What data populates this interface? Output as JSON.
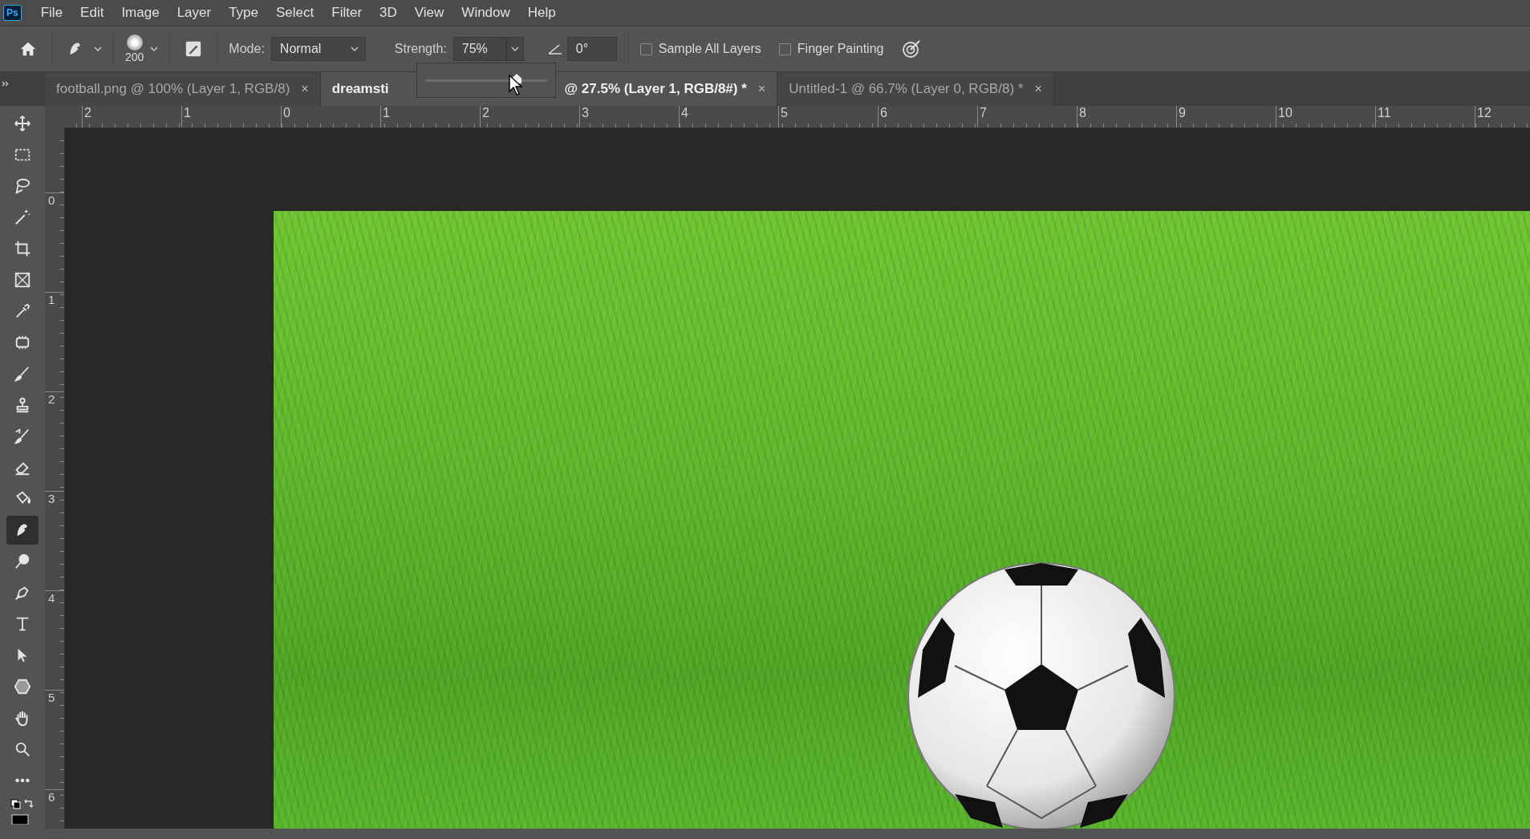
{
  "app_logo": "Ps",
  "menu": [
    "File",
    "Edit",
    "Image",
    "Layer",
    "Type",
    "Select",
    "Filter",
    "3D",
    "View",
    "Window",
    "Help"
  ],
  "options_bar": {
    "brush_size": "200",
    "mode_label": "Mode:",
    "mode_value": "Normal",
    "strength_label": "Strength:",
    "strength_value": "75%",
    "strength_slider": {
      "level": 0.75
    },
    "angle_value": "0°",
    "checkboxes": [
      {
        "label": "Sample All Layers",
        "checked": false
      },
      {
        "label": "Finger Painting",
        "checked": false
      }
    ]
  },
  "tabs": [
    {
      "label": "football.png @ 100% (Layer 1, RGB/8)",
      "close": "×",
      "selected": false
    },
    {
      "label": "dreamsti",
      "hidden_part": "@ 27.5% (Layer 1, RGB/8#) *",
      "close": "×",
      "selected": true
    },
    {
      "label": "Untitled-1 @ 66.7% (Layer 0, RGB/8) *",
      "close": "×",
      "selected": false
    }
  ],
  "ruler_h": [
    "2",
    "1",
    "0",
    "1",
    "2",
    "3",
    "4",
    "5",
    "6",
    "7",
    "8",
    "9",
    "10",
    "11",
    "12"
  ],
  "ruler_v": [
    "0",
    "1",
    "2",
    "3",
    "4",
    "5",
    "6"
  ],
  "tools": [
    {
      "kind": "move",
      "selected": false
    },
    {
      "kind": "marquee",
      "selected": false
    },
    {
      "kind": "lasso",
      "selected": false
    },
    {
      "kind": "wand",
      "selected": false
    },
    {
      "kind": "crop",
      "selected": false
    },
    {
      "kind": "frame",
      "selected": false
    },
    {
      "kind": "eyedropper",
      "selected": false
    },
    {
      "kind": "patch",
      "selected": false
    },
    {
      "kind": "brush",
      "selected": false
    },
    {
      "kind": "stamp",
      "selected": false
    },
    {
      "kind": "history",
      "selected": false
    },
    {
      "kind": "eraser",
      "selected": false
    },
    {
      "kind": "bucket",
      "selected": false
    },
    {
      "kind": "smudge",
      "selected": true
    },
    {
      "kind": "dodge",
      "selected": false
    },
    {
      "kind": "pen",
      "selected": false
    },
    {
      "kind": "type",
      "selected": false
    },
    {
      "kind": "select",
      "selected": false
    },
    {
      "kind": "shape",
      "selected": false
    },
    {
      "kind": "hand",
      "selected": false
    },
    {
      "kind": "zoom",
      "selected": false
    },
    {
      "kind": "more",
      "selected": false
    }
  ]
}
